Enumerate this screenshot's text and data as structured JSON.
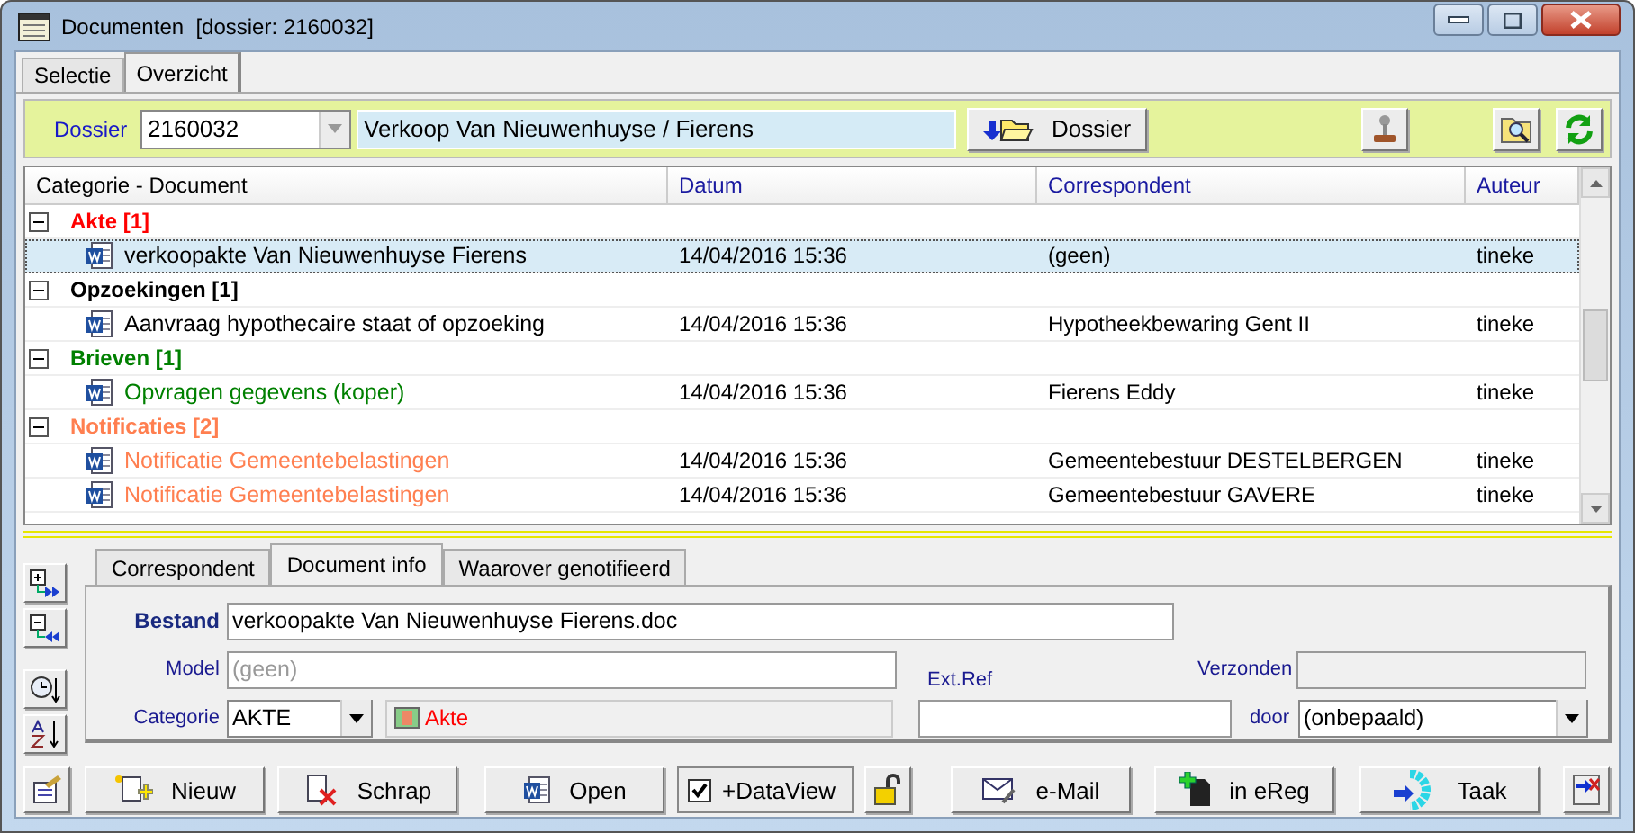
{
  "window": {
    "title": "Documenten  [dossier: 2160032]"
  },
  "tabs": [
    {
      "label": "Selectie",
      "selected": false
    },
    {
      "label": "Overzicht",
      "selected": true
    }
  ],
  "toolbar": {
    "dossier_label": "Dossier",
    "dossier_number": "2160032",
    "dossier_description": "Verkoop Van Nieuwenhuyse / Fierens",
    "dossier_button": "Dossier"
  },
  "table": {
    "columns": [
      "Categorie - Document",
      "Datum",
      "Correspondent",
      "Auteur"
    ],
    "groups": [
      {
        "label": "Akte [1]",
        "color": "#ff0000",
        "expanded": true,
        "rows": [
          {
            "document": "verkoopakte Van Nieuwenhuyse Fierens",
            "color": "#000000",
            "datum": "14/04/2016 15:36",
            "correspondent": "(geen)",
            "auteur": "tineke",
            "selected": true
          }
        ]
      },
      {
        "label": "Opzoekingen [1]",
        "color": "#000000",
        "expanded": true,
        "rows": [
          {
            "document": "Aanvraag hypothecaire staat of opzoeking",
            "color": "#000000",
            "datum": "14/04/2016 15:36",
            "correspondent": "Hypotheekbewaring Gent II",
            "auteur": "tineke",
            "selected": false
          }
        ]
      },
      {
        "label": "Brieven [1]",
        "color": "#008000",
        "expanded": true,
        "rows": [
          {
            "document": "Opvragen gegevens (koper)",
            "color": "#008000",
            "datum": "14/04/2016 15:36",
            "correspondent": "Fierens Eddy",
            "auteur": "tineke",
            "selected": false
          }
        ]
      },
      {
        "label": "Notificaties [2]",
        "color": "#ff7f50",
        "expanded": true,
        "rows": [
          {
            "document": "Notificatie Gemeentebelastingen",
            "color": "#ff7f50",
            "datum": "14/04/2016 15:36",
            "correspondent": "Gemeentebestuur DESTELBERGEN",
            "auteur": "tineke",
            "selected": false
          },
          {
            "document": "Notificatie Gemeentebelastingen",
            "color": "#ff7f50",
            "datum": "14/04/2016 15:36",
            "correspondent": "Gemeentebestuur GAVERE",
            "auteur": "tineke",
            "selected": false
          }
        ]
      }
    ]
  },
  "detail_tabs": [
    {
      "label": "Correspondent",
      "selected": false
    },
    {
      "label": "Document info",
      "selected": true
    },
    {
      "label": "Waarover genotifieerd",
      "selected": false
    }
  ],
  "document_info": {
    "bestand_label": "Bestand",
    "bestand": "verkoopakte Van Nieuwenhuyse Fierens.doc",
    "model_label": "Model",
    "model_placeholder": "(geen)",
    "categorie_label": "Categorie",
    "categorie": "AKTE",
    "categorie_name": "Akte",
    "ext_ref_label": "Ext.Ref",
    "verzonden_label": "Verzonden",
    "door_label": "door",
    "door": "(onbepaald)"
  },
  "buttons": [
    {
      "kind": "properties"
    },
    {
      "kind": "new",
      "label": "Nieuw"
    },
    {
      "kind": "delete",
      "label": "Schrap"
    },
    {
      "kind": "open",
      "label": "Open"
    },
    {
      "kind": "checkbox",
      "label": "+DataView",
      "checked": true
    },
    {
      "kind": "lock"
    },
    {
      "kind": "mail",
      "label": "e-Mail"
    },
    {
      "kind": "register",
      "label": "in eReg"
    },
    {
      "kind": "task",
      "label": "Taak"
    },
    {
      "kind": "export"
    }
  ]
}
